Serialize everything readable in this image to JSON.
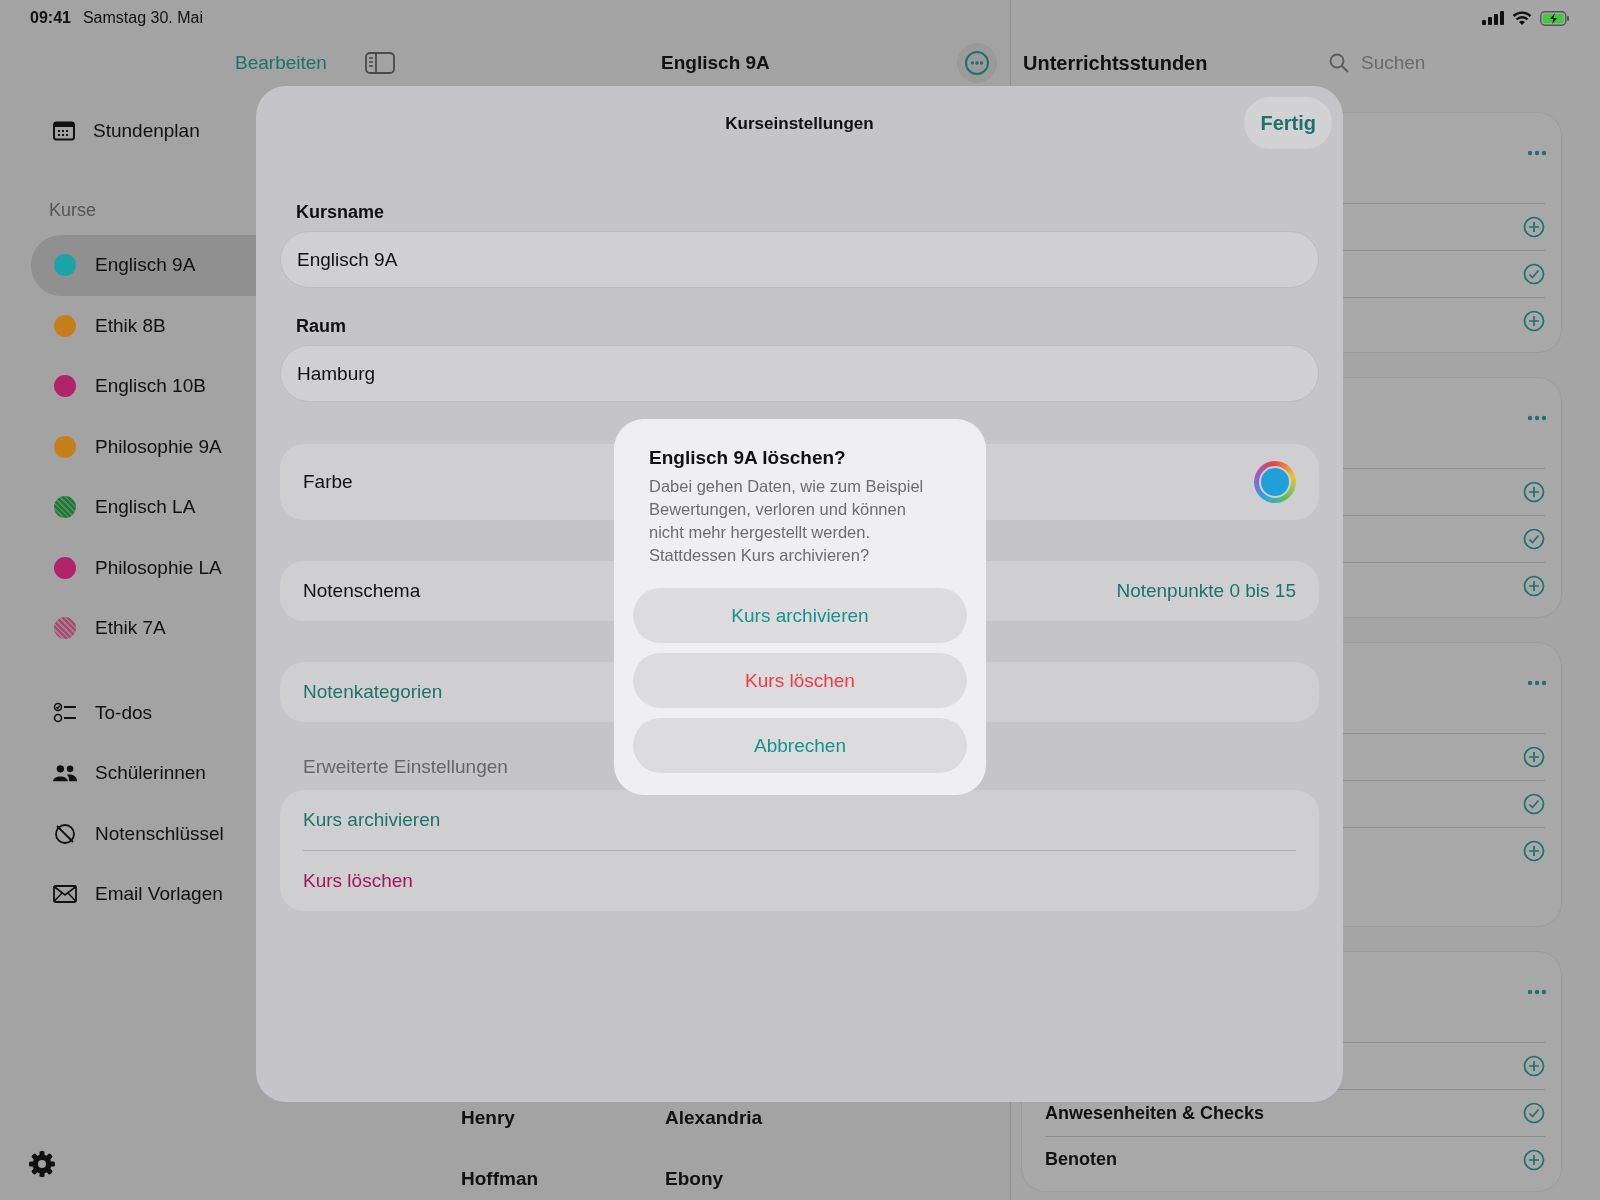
{
  "status_bar": {
    "time": "09:41",
    "date": "Samstag 30. Mai"
  },
  "sidebar": {
    "schedule": {
      "label": "Stundenplan"
    },
    "section_title": "Kurse",
    "courses": [
      {
        "label": "Englisch 9A",
        "color": "#1aa3a8",
        "patterned": false,
        "selected": true
      },
      {
        "label": "Ethik 8B",
        "color": "#c47f1a",
        "patterned": false,
        "selected": false
      },
      {
        "label": "Englisch 10B",
        "color": "#b0226a",
        "patterned": false,
        "selected": false
      },
      {
        "label": "Philosophie 9A",
        "color": "#c47f1a",
        "patterned": false,
        "selected": false
      },
      {
        "label": "Englisch LA",
        "color": "#3c9450",
        "patterned": true,
        "selected": false
      },
      {
        "label": "Philosophie LA",
        "color": "#b0226a",
        "patterned": false,
        "selected": false
      },
      {
        "label": "Ethik 7A",
        "color": "#c0708f",
        "patterned": true,
        "selected": false
      }
    ],
    "tools": [
      {
        "label": "To-dos"
      },
      {
        "label": "Schülerinnen"
      },
      {
        "label": "Notenschlüssel"
      },
      {
        "label": "Email Vorlagen"
      }
    ]
  },
  "middle": {
    "edit_button": "Bearbeiten",
    "title": "Englisch 9A",
    "students": [
      {
        "first": "Henry",
        "second": "Alexandria"
      },
      {
        "first": "Hoffman",
        "second": "Ebony"
      }
    ]
  },
  "right_panel": {
    "title": "Unterrichtsstunden",
    "search": {
      "placeholder": "Suchen"
    },
    "cards": [
      {
        "rows": [
          {
            "kind": "add"
          },
          {
            "kind": "check"
          },
          {
            "kind": "add"
          }
        ]
      },
      {
        "rows": [
          {
            "kind": "add"
          },
          {
            "kind": "check"
          },
          {
            "kind": "add"
          }
        ]
      },
      {
        "rows": [
          {
            "kind": "add"
          },
          {
            "kind": "check"
          },
          {
            "kind": "add"
          }
        ]
      },
      {
        "rows": [
          {
            "kind": "add"
          },
          {
            "kind": "check",
            "label": "Anwesenheiten & Checks"
          },
          {
            "kind": "add",
            "label": "Benoten"
          }
        ]
      }
    ]
  },
  "sheet": {
    "title": "Kurseinstellungen",
    "done_button": "Fertig",
    "course_name": {
      "label": "Kursname",
      "value": "Englisch 9A"
    },
    "room": {
      "label": "Raum",
      "value": "Hamburg"
    },
    "color_row": {
      "label": "Farbe",
      "color": "#1ea0d8"
    },
    "grading_row": {
      "label": "Notenschema",
      "value": "Notenpunkte 0 bis 15"
    },
    "categories_link": "Notenkategorien",
    "advanced": {
      "header": "Erweiterte Einstellungen",
      "actions": [
        {
          "label": "Kurs archivieren",
          "kind": "normal"
        },
        {
          "label": "Kurs löschen",
          "kind": "destructive"
        }
      ]
    }
  },
  "alert": {
    "title": "Englisch 9A löschen?",
    "message": "Dabei gehen Daten, wie zum Beispiel Bewertungen, verloren und können nicht mehr hergestellt werden. Stattdessen Kurs archivieren?",
    "buttons": [
      {
        "label": "Kurs archivieren",
        "kind": "normal"
      },
      {
        "label": "Kurs löschen",
        "kind": "destructive"
      },
      {
        "label": "Abbrechen",
        "kind": "cancel"
      }
    ]
  }
}
